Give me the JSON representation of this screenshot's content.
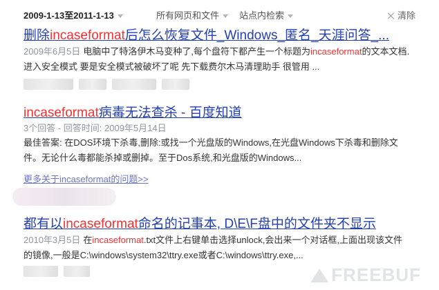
{
  "filters": {
    "date_range": "2009-1-13至2011-1-13",
    "scope": "所有网页和文件",
    "site": "站点内检索",
    "clear": "清除"
  },
  "results": [
    {
      "title_parts": [
        "删除",
        "incaseformat",
        "后怎么恢复文件_Windows_匿名_天涯问答_..."
      ],
      "date": "2009年6月5日",
      "snippet_line1_parts": [
        "电脑中了特洛伊木马变种了,每个盘符下都产生一个标题为",
        "incaseformat",
        "的文本文档."
      ],
      "snippet_line2": "进入安全模式 要是安全模式被破坏了呢 先下载费尔木马清理助手 很管用 ..."
    },
    {
      "title_parts": [
        "incaseformat",
        "病毒无法查杀 - 百度知道"
      ],
      "meta": "3个回答 - 回答时间: 2009年5月14日",
      "snippet_line1": "最佳答案: 在DOS环境下杀毒,删除:或找一个光盘版的Windows,在光盘Windows下杀毒和删除文",
      "snippet_line2": "件。无论什么毒都能杀掉或删掉。至于Dos系统,和光盘版的Windows...",
      "more_link": "更多关于incaseformat的问题>>"
    },
    {
      "title_parts": [
        "都有以",
        "incaseformat",
        "命名的记事本, D\\E\\F盘中的文件夹不显示"
      ],
      "date": "2010年3月5日",
      "snippet_line1_parts": [
        "在",
        "incaseformat",
        ".txt文件上右键单击选择unlock,会出来一个对话框,上面出现该文件"
      ],
      "snippet_line2": "的镜像,一般是C:\\windows\\system32\\ttry.exe或者C:\\windows\\ttry.exe,..."
    }
  ],
  "watermark": "FREEBUF"
}
